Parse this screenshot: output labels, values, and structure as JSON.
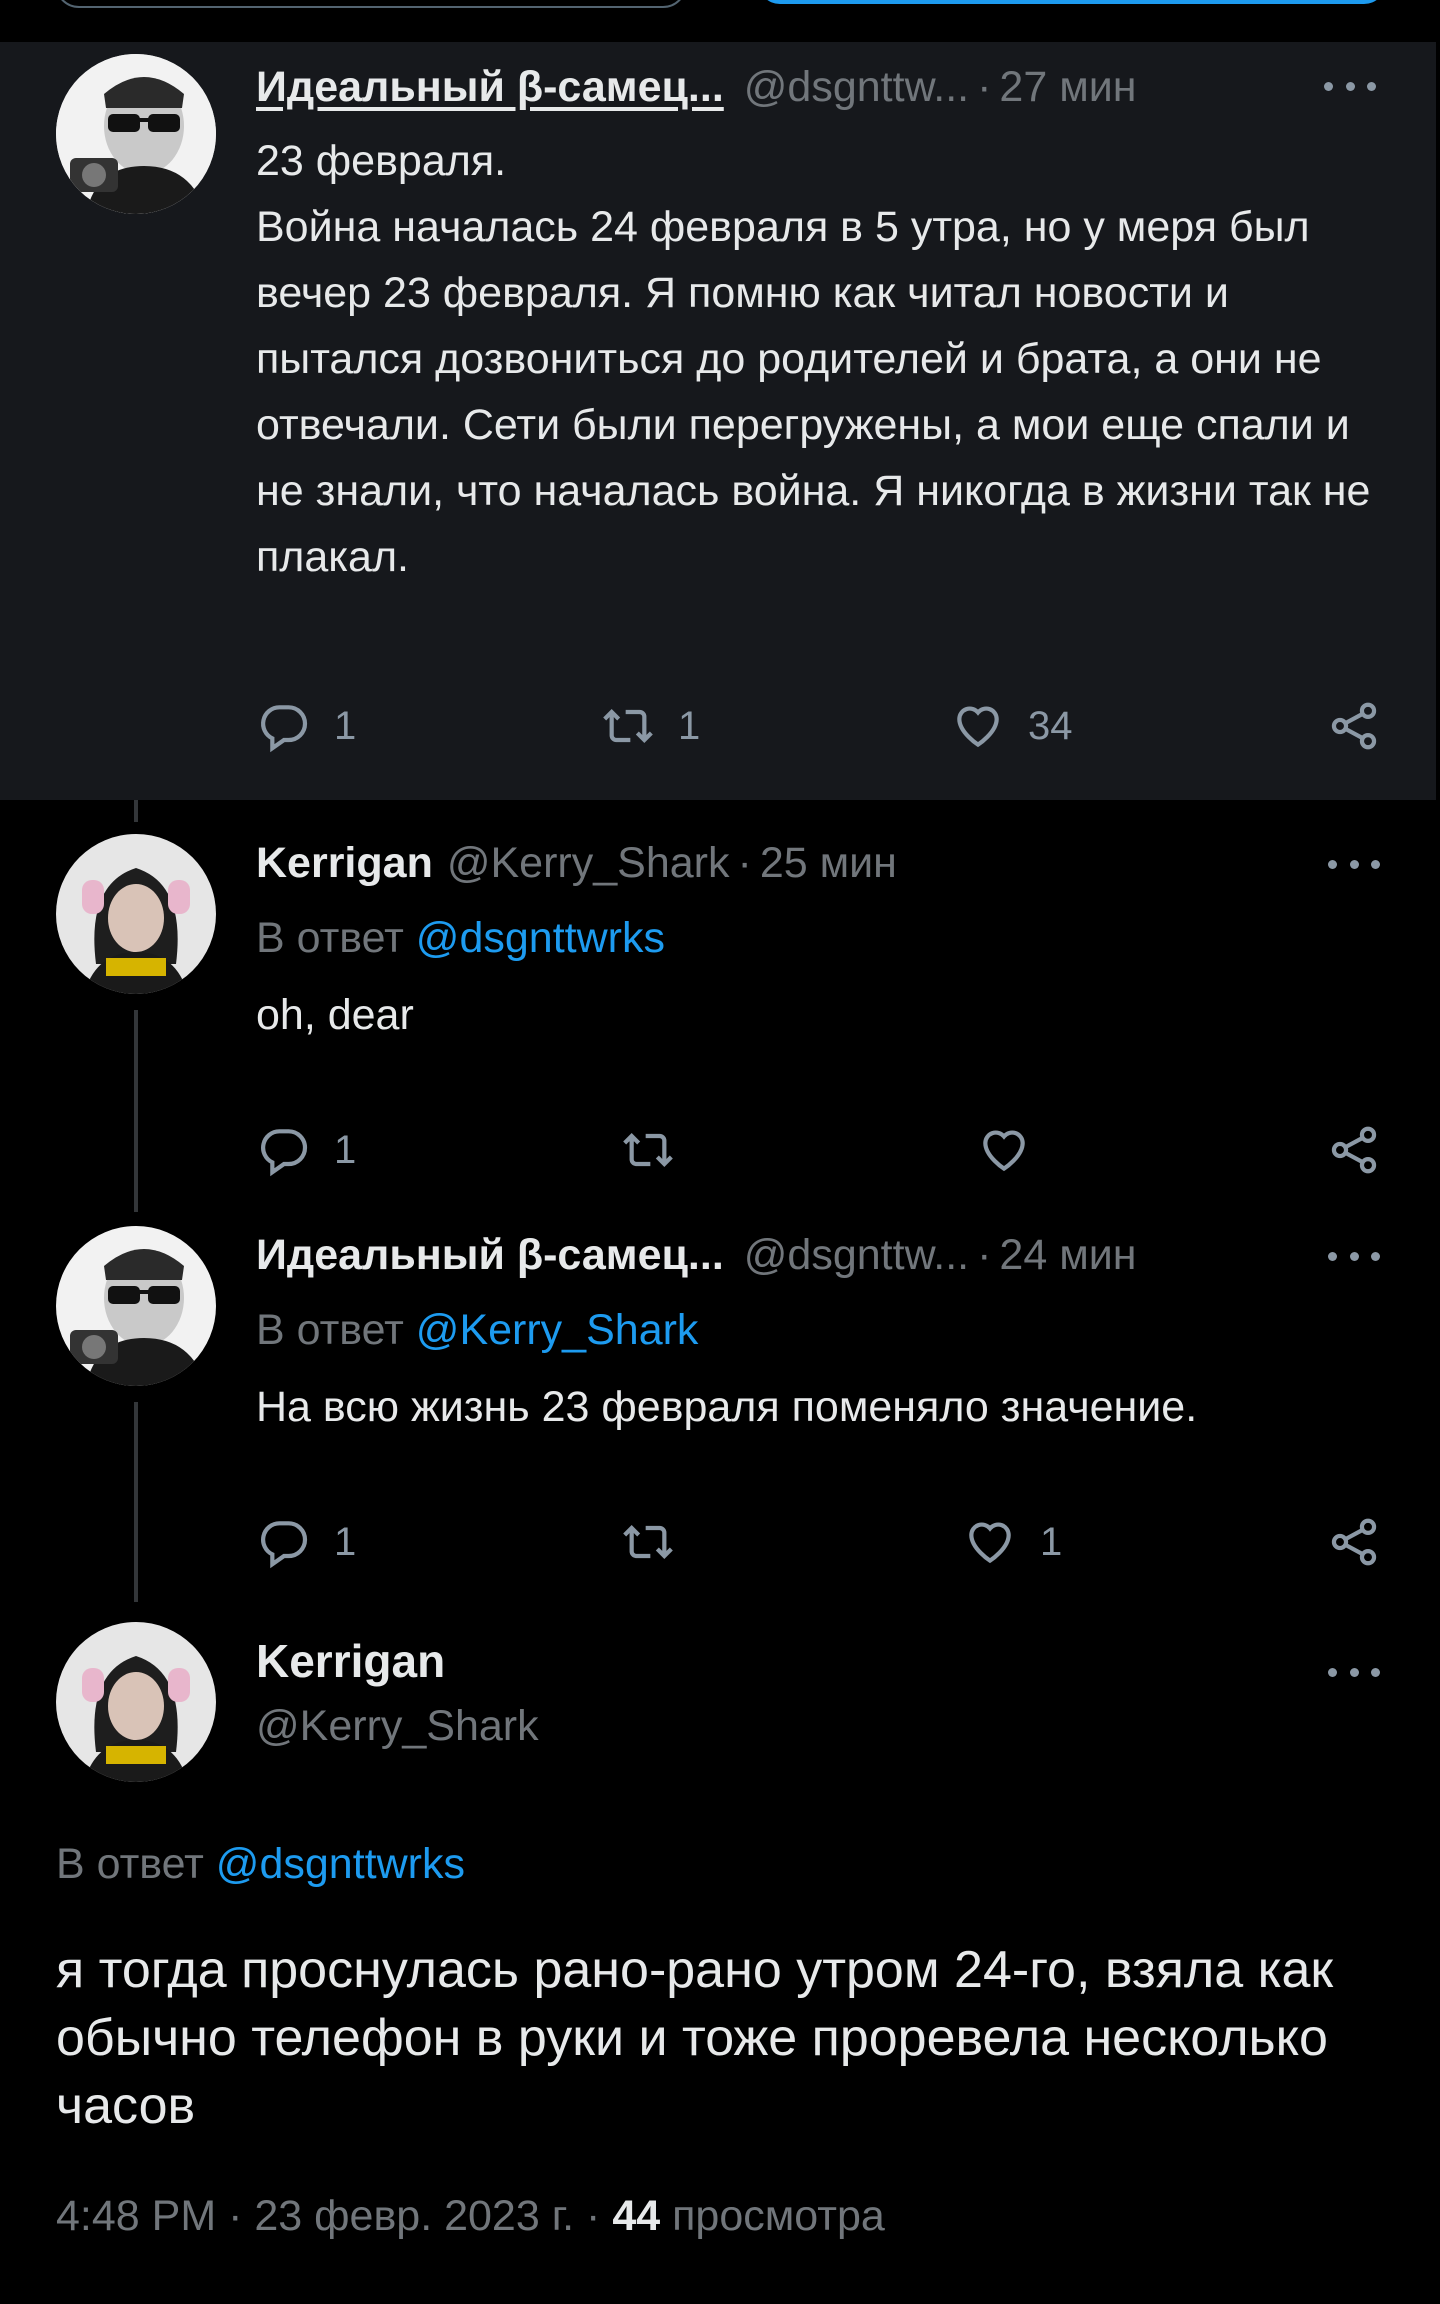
{
  "colors": {
    "background": "#000000",
    "highlight": "#16181c",
    "link": "#1d9bf0",
    "muted": "#71767b",
    "text": "#e7e9ea"
  },
  "tweets": [
    {
      "name": "Идеальный β-самец...",
      "handle": "@dsgnttw...",
      "sep": "·",
      "time": "27 мин",
      "text": "23 февраля.\nВойна началась 24 февраля в 5 утра, но у меря был вечер 23 февраля. Я помню как читал новости и пытался дозвониться до родителей и брата, а они не отвечали. Сети были перегружены, а мои еще спали и не знали, что началась война. Я никогда в жизни так не плакал.",
      "replies": "1",
      "retweets": "1",
      "likes": "34"
    },
    {
      "name": "Kerrigan",
      "handle": "@Kerry_Shark",
      "sep": "·",
      "time": "25 мин",
      "reply_prefix": "В ответ",
      "reply_to": "@dsgnttwrks",
      "text": "oh, dear",
      "replies": "1",
      "retweets": "",
      "likes": ""
    },
    {
      "name": "Идеальный β-самец...",
      "handle": "@dsgnttw...",
      "sep": "·",
      "time": "24 мин",
      "reply_prefix": "В ответ",
      "reply_to": "@Kerry_Shark",
      "text": "На всю жизнь 23 февраля поменяло значение.",
      "replies": "1",
      "retweets": "",
      "likes": "1"
    }
  ],
  "main_tweet": {
    "name": "Kerrigan",
    "handle": "@Kerry_Shark",
    "reply_prefix": "В ответ",
    "reply_to": "@dsgnttwrks",
    "text": "я тогда проснулась рано-рано утром 24-го, взяла как обычно телефон в руки и тоже проревела несколько часов",
    "time": "4:48 PM",
    "sep1": "·",
    "date": "23 февр. 2023 г.",
    "sep2": "·",
    "views": "44",
    "views_label": "просмотра"
  },
  "icons": [
    "reply-icon",
    "retweet-icon",
    "like-icon",
    "share-icon",
    "more-icon"
  ]
}
